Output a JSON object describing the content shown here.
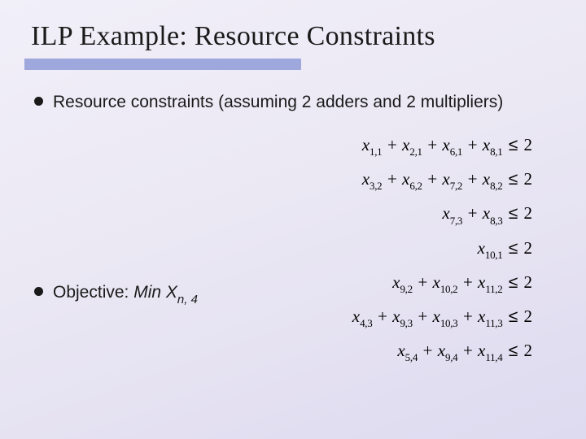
{
  "title": "ILP Example: Resource Constraints",
  "bullets": {
    "b1": "Resource constraints (assuming 2 adders and 2 multipliers)",
    "b2_prefix": "Objective: ",
    "b2_min": "Min X",
    "b2_sub": "n, 4"
  },
  "eq": {
    "r1": {
      "t1": "x",
      "s1": "1,1",
      "t2": " + x",
      "s2": "2,1",
      "t3": " + x",
      "s3": "6,1",
      "t4": " + x",
      "s4": "8,1",
      "rhs": " 2"
    },
    "r2": {
      "t1": "x",
      "s1": "3,2",
      "t2": " + x",
      "s2": "6,2",
      "t3": " + x",
      "s3": "7,2",
      "t4": " + x",
      "s4": "8,2",
      "rhs": " 2"
    },
    "r3": {
      "t1": "x",
      "s1": "7,3",
      "t2": " + x",
      "s2": "8,3",
      "rhs": " 2"
    },
    "r4": {
      "t1": "x",
      "s1": "10,1",
      "rhs": " 2"
    },
    "r5": {
      "t1": "x",
      "s1": "9,2",
      "t2": " + x",
      "s2": "10,2",
      "t3": " + x",
      "s3": "11,2",
      "rhs": " 2"
    },
    "r6": {
      "t1": "x",
      "s1": "4,3",
      "t2": " + x",
      "s2": "9,3",
      "t3": " + x",
      "s3": "10,3",
      "t4": " + x",
      "s4": "11,3",
      "rhs": " 2"
    },
    "r7": {
      "t1": "x",
      "s1": "5,4",
      "t2": " + x",
      "s2": "9,4",
      "t3": " + x",
      "s3": "11,4",
      "rhs": " 2"
    }
  },
  "sym": {
    "le": "≤"
  }
}
